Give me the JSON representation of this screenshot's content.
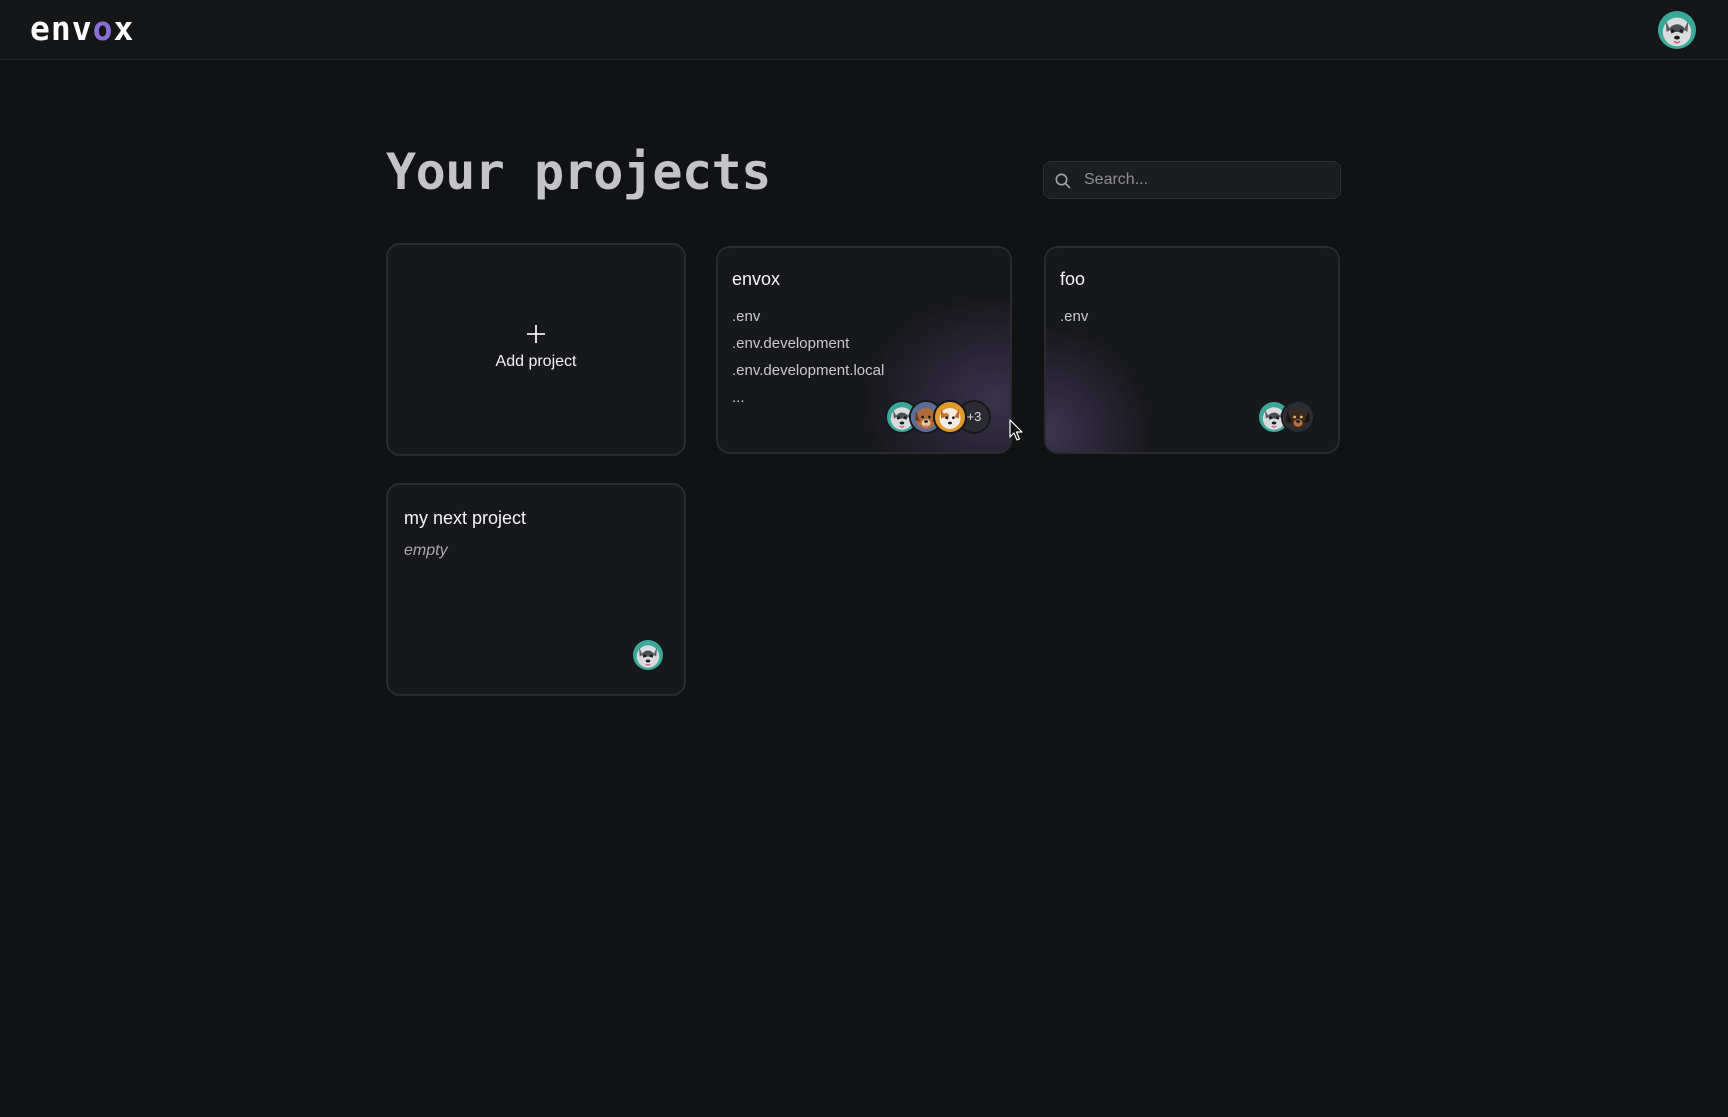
{
  "app": {
    "logo_text_start": "env",
    "logo_text_accent": "o",
    "logo_text_end": "x",
    "accent_color": "#8b6fd6"
  },
  "header": {
    "title": "Your projects",
    "search_placeholder": "Search...",
    "search_value": ""
  },
  "add_card": {
    "label": "Add project",
    "icon": "plus-icon"
  },
  "projects": [
    {
      "name": "envox",
      "files": [
        ".env",
        ".env.development",
        ".env.development.local",
        "..."
      ],
      "members": [
        "husky-avatar",
        "dog-avatar",
        "dog-avatar"
      ],
      "more_count": "+3"
    },
    {
      "name": "foo",
      "files": [
        ".env"
      ],
      "members": [
        "husky-avatar",
        "dog-avatar"
      ]
    },
    {
      "name": "my next project",
      "empty_label": "empty",
      "members": [
        "husky-avatar"
      ]
    }
  ]
}
